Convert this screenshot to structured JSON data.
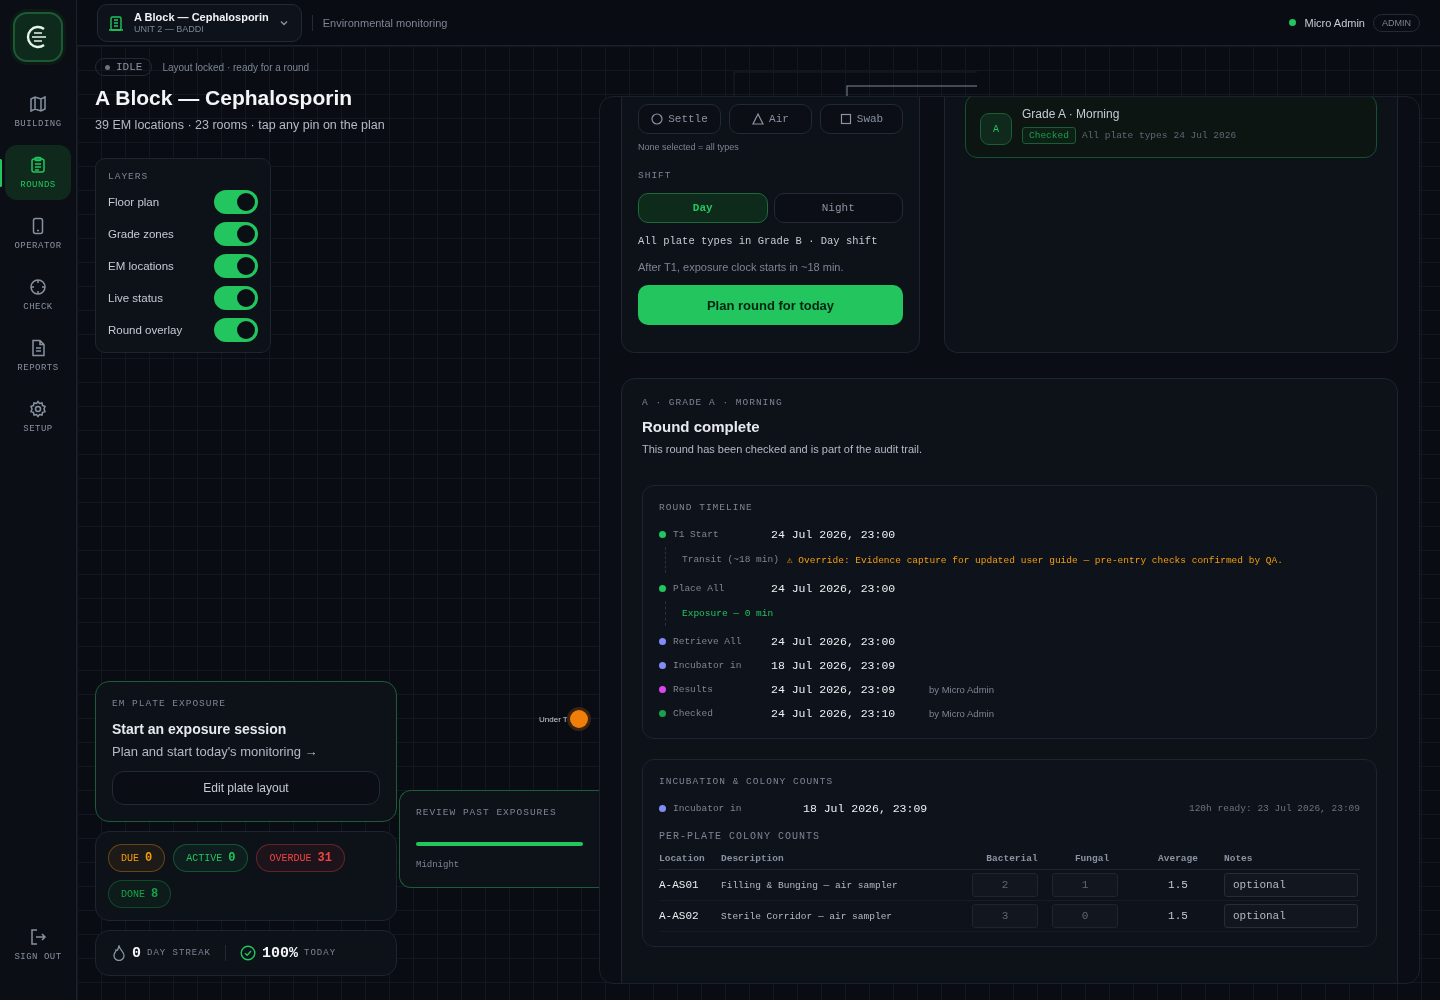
{
  "sidebar": {
    "items": [
      {
        "label": "BUILDING",
        "selected": false
      },
      {
        "label": "ROUNDS",
        "selected": true
      },
      {
        "label": "OPERATOR",
        "selected": false
      },
      {
        "label": "CHECK",
        "selected": false
      },
      {
        "label": "REPORTS",
        "selected": false
      },
      {
        "label": "SETUP",
        "selected": false
      }
    ],
    "sign_out": "SIGN OUT"
  },
  "topbar": {
    "site": {
      "name": "A Block — Cephalosporin",
      "unit": "UNIT 2 — BADDI"
    },
    "section": "Environmental monitoring",
    "user": {
      "name": "Micro Admin",
      "role": "ADMIN",
      "online": true
    }
  },
  "status": {
    "state": "IDLE",
    "note": "Layout locked · ready for a round"
  },
  "title": "A Block — Cephalosporin",
  "subtitle": "39 EM locations · 23 rooms · tap any pin on the plan",
  "layers": {
    "heading": "LAYERS",
    "items": [
      {
        "label": "Floor plan",
        "on": true
      },
      {
        "label": "Grade zones",
        "on": true
      },
      {
        "label": "EM locations",
        "on": true
      },
      {
        "label": "Live status",
        "on": true
      },
      {
        "label": "Round overlay",
        "on": true
      }
    ]
  },
  "map": {
    "pin": {
      "label": "Under T",
      "color": "#f07f0a"
    }
  },
  "exposure_card": {
    "eyebrow": "EM PLATE EXPOSURE",
    "title": "Start an exposure session",
    "link": "Plan and start today's monitoring →",
    "button": "Edit plate layout"
  },
  "counters": [
    {
      "label": "DUE",
      "value": "0",
      "color": "#f59e0b"
    },
    {
      "label": "ACTIVE",
      "value": "0",
      "color": "#22c55e"
    },
    {
      "label": "OVERDUE",
      "value": "31",
      "color": "#ef4444"
    },
    {
      "label": "DONE",
      "value": "8",
      "color": "#16a34a"
    }
  ],
  "streak": {
    "value": "0",
    "label": "DAY STREAK",
    "percent": "100%",
    "percent_label": "TODAY"
  },
  "review": {
    "heading": "REVIEW PAST EXPOSURES",
    "level": 1,
    "caption": "Midnight"
  },
  "planner": {
    "plate_types": [
      {
        "label": "Settle",
        "kind": "circle",
        "selected": false
      },
      {
        "label": "Air",
        "kind": "triangle",
        "selected": false
      },
      {
        "label": "Swab",
        "kind": "square",
        "selected": false
      }
    ],
    "plate_hint": "None selected = all types",
    "shift_heading": "SHIFT",
    "shifts": [
      {
        "label": "Day",
        "selected": true
      },
      {
        "label": "Night",
        "selected": false
      }
    ],
    "summary": "All plate types in Grade B · Day shift",
    "note": "After T1, exposure clock starts in ~18 min.",
    "button": "Plan round for today"
  },
  "rounds": [
    {
      "badge": "A",
      "title": "Grade A · Morning",
      "status": "Checked",
      "types": "All plate types",
      "date": "24 Jul 2026"
    }
  ],
  "round_detail": {
    "eyebrow": "A · GRADE A · MORNING",
    "title": "Round complete",
    "description": "This round has been checked and is part of the audit trail.",
    "timeline": {
      "heading": "ROUND TIMELINE",
      "events": [
        {
          "kind": "event",
          "label": "T1 Start",
          "time": "24 Jul 2026, 23:00",
          "color": "#22c55e"
        },
        {
          "kind": "transit",
          "label": "Transit (~18 min)",
          "warning": "⚠ Override: Evidence capture for updated user guide — pre-entry checks confirmed by QA."
        },
        {
          "kind": "event",
          "label": "Place All",
          "time": "24 Jul 2026, 23:00",
          "color": "#22c55e"
        },
        {
          "kind": "exposure",
          "label": "Exposure — 0 min"
        },
        {
          "kind": "event",
          "label": "Retrieve All",
          "time": "24 Jul 2026, 23:00",
          "color": "#818cf8"
        },
        {
          "kind": "event",
          "label": "Incubator in",
          "time": "18 Jul 2026, 23:09",
          "color": "#818cf8"
        },
        {
          "kind": "event",
          "label": "Results",
          "time": "24 Jul 2026, 23:09",
          "color": "#d946ef",
          "by": "by Micro Admin"
        },
        {
          "kind": "event",
          "label": "Checked",
          "time": "24 Jul 2026, 23:10",
          "color": "#16a34a",
          "by": "by Micro Admin"
        }
      ]
    }
  },
  "incubation": {
    "heading": "INCUBATION & COLONY COUNTS",
    "label": "Incubator in",
    "time": "18 Jul 2026, 23:09",
    "color": "#818cf8",
    "ready": "120h ready: 23 Jul 2026, 23:09",
    "counts_heading": "PER-PLATE COLONY COUNTS",
    "columns": [
      "Location",
      "Description",
      "Bacterial",
      "Fungal",
      "Average",
      "Notes"
    ],
    "rows": [
      {
        "location": "A-AS01",
        "description": "Filling & Bunging — air sampler",
        "bacterial": "2",
        "fungal": "1",
        "average": "1.5",
        "notes_placeholder": "optional"
      },
      {
        "location": "A-AS02",
        "description": "Sterile Corridor — air sampler",
        "bacterial": "3",
        "fungal": "0",
        "average": "1.5",
        "notes_placeholder": "optional"
      }
    ]
  }
}
